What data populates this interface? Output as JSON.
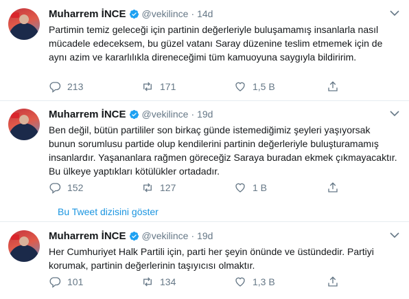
{
  "tweets": [
    {
      "name": "Muharrem İNCE",
      "handle": "@vekilince",
      "separator": "·",
      "time": "14d",
      "text": "Partimin temiz geleceği için partinin değerleriyle buluşamamış insanlarla nasıl mücadele edeceksem, bu güzel vatanı Saray düzenine teslim etmemek için de aynı azim ve kararlılıkla direneceğimi tüm kamuoyuna saygıyla bildiririm.",
      "replies": "213",
      "retweets": "171",
      "likes": "1,5 B"
    },
    {
      "name": "Muharrem İNCE",
      "handle": "@vekilince",
      "separator": "·",
      "time": "19d",
      "text": "Ben değil, bütün partililer son birkaç günde istemediğimiz şeyleri yaşıyorsak bunun sorumlusu partide olup kendilerini partinin değerleriyle buluşturamamış insanlardır. Yaşananlara rağmen göreceğiz Saraya buradan ekmek çıkmayacaktır. Bu ülkeye yaptıkları kötülükler ortadadır.",
      "replies": "152",
      "retweets": "127",
      "likes": "1 B"
    },
    {
      "name": "Muharrem İNCE",
      "handle": "@vekilince",
      "separator": "·",
      "time": "19d",
      "text": "Her Cumhuriyet Halk Partili için, parti her şeyin önünde ve üstündedir. Partiyi korumak, partinin değerlerinin taşıyıcısı olmaktır.",
      "replies": "101",
      "retweets": "134",
      "likes": "1,3 B"
    }
  ],
  "thread_link": "Bu Tweet dizisini göster",
  "colors": {
    "text": "#14171a",
    "secondary": "#657786",
    "link": "#1b95e0",
    "verified": "#1da1f2",
    "divider": "#e6ecf0"
  }
}
